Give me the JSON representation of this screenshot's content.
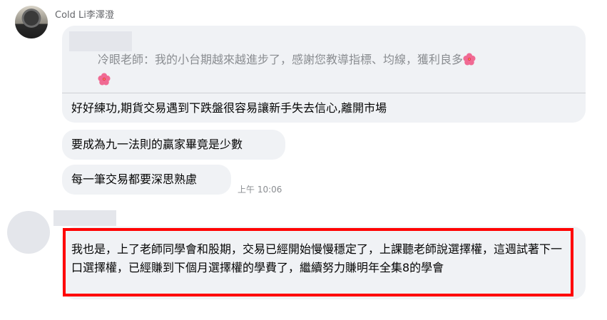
{
  "sender": {
    "name": "Cold Li李澤澄"
  },
  "quoted": {
    "text": "冷眼老師：我的小台期越來越進步了，感謝您教導指標、均線，獲利良多"
  },
  "messages": [
    "好好練功,期貨交易遇到下跌盤很容易讓新手失去信心,離開市場",
    "要成為九一法則的贏家畢竟是少數",
    "每一筆交易都要深思熟慮"
  ],
  "timestamp": "上午 10:06",
  "highlighted_message": "我也是，上了老師同學會和股期，交易已經開始慢慢穩定了，上課聽老師說選擇權，這週試著下一口選擇權，已經賺到下個月選擇權的學費了，繼續努力賺明年全集8的學會",
  "colors": {
    "highlight_border": "#ff0000",
    "bubble_bg": "#f0f2f5"
  }
}
